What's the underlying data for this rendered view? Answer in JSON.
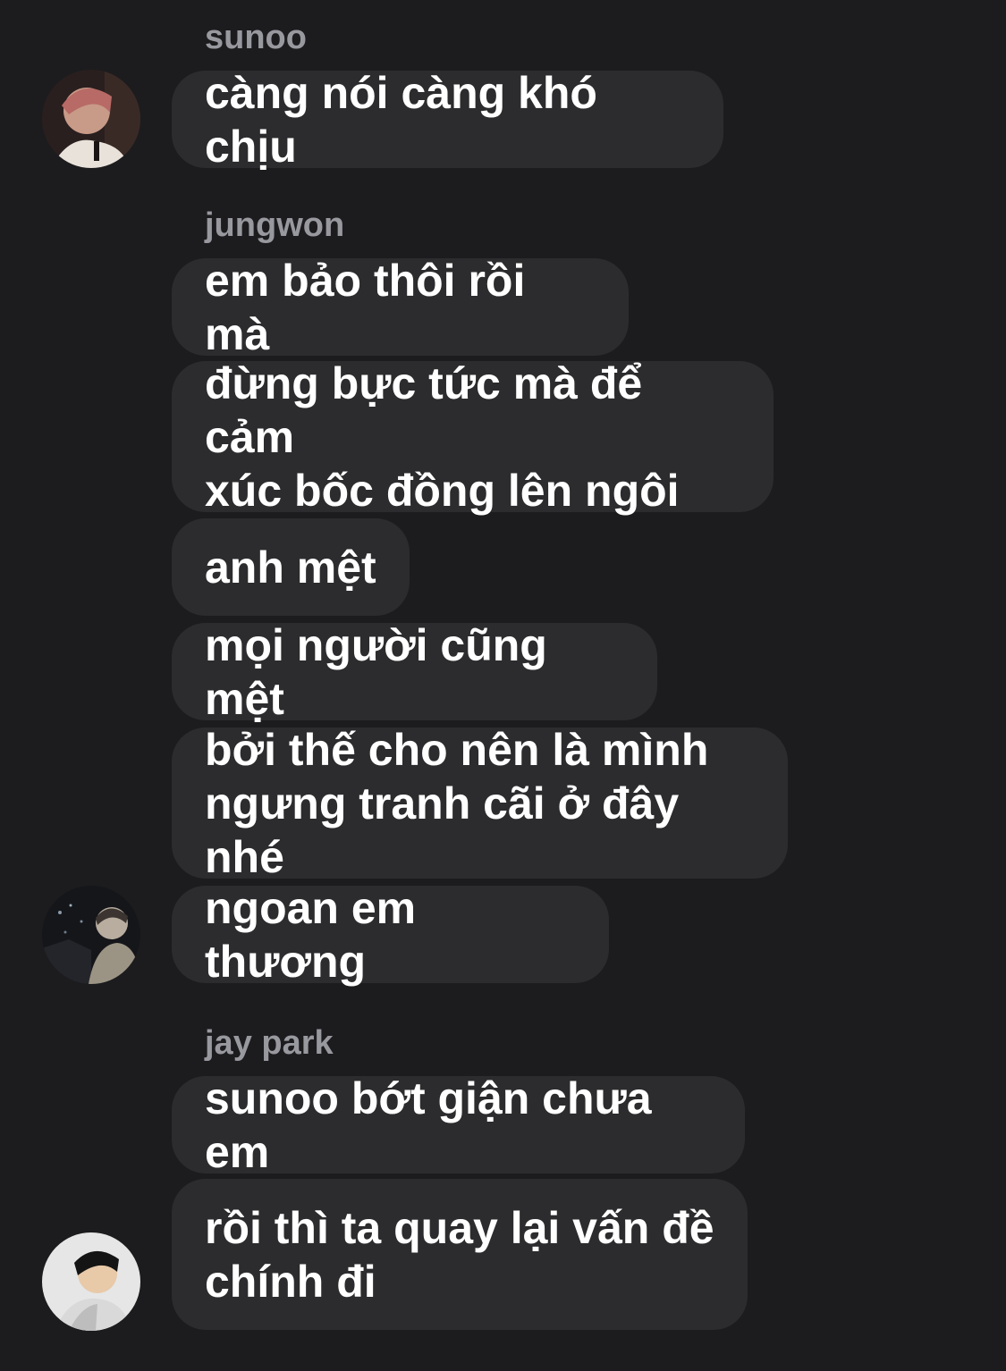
{
  "conversation": {
    "groups": [
      {
        "sender": "sunoo",
        "messages": [
          "càng nói càng khó chịu"
        ]
      },
      {
        "sender": "jungwon",
        "messages": [
          "em bảo thôi rồi mà",
          "đừng bực tức mà để cảm\nxúc bốc đồng lên ngôi",
          "anh mệt",
          "mọi người cũng mệt",
          "bởi thế cho nên là mình\nngưng tranh cãi ở đây nhé",
          "ngoan em thương"
        ]
      },
      {
        "sender": "jay park",
        "messages": [
          "sunoo bớt giận chưa em",
          "rồi thì ta quay lại vấn đề\nchính đi"
        ]
      }
    ]
  },
  "colors": {
    "background": "#1c1c1e",
    "bubble": "#2c2c2e",
    "sender_name": "#98989f",
    "message_text": "#ffffff"
  },
  "icons": {
    "avatar_sunoo": "avatar-photo-icon",
    "avatar_jungwon": "avatar-photo-icon",
    "avatar_jay": "avatar-photo-icon"
  }
}
